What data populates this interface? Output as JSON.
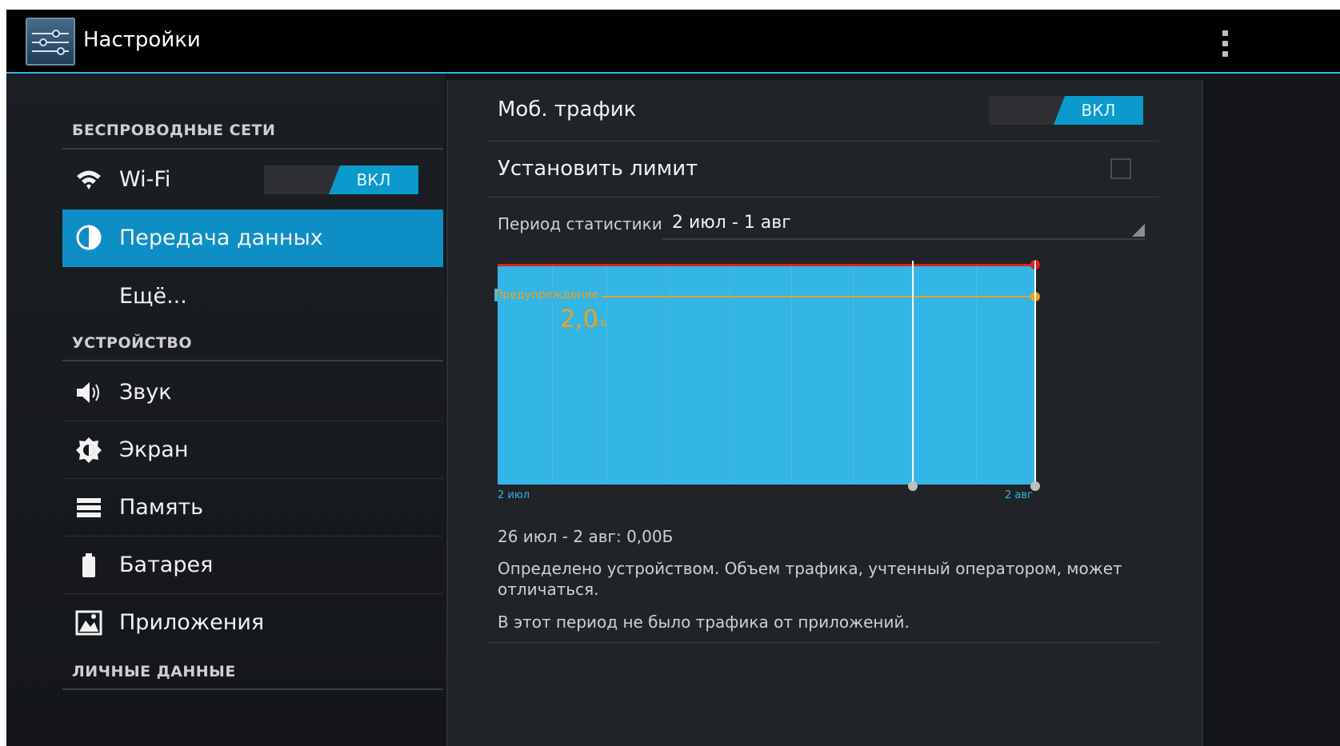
{
  "app": {
    "title": "Настройки",
    "icon": "settings-sliders-icon"
  },
  "sidebar": {
    "sections": [
      {
        "label": "БЕСПРОВОДНЫЕ СЕТИ"
      },
      {
        "label": "УСТРОЙСТВО"
      },
      {
        "label": "ЛИЧНЫЕ ДАННЫЕ"
      }
    ],
    "items": [
      {
        "label": "Wi-Fi",
        "icon": "wifi-icon",
        "toggle": "ВКЛ"
      },
      {
        "label": "Передача данных",
        "icon": "data-usage-icon",
        "selected": true
      },
      {
        "label": "Ещё...",
        "icon": ""
      },
      {
        "label": "Звук",
        "icon": "volume-icon"
      },
      {
        "label": "Экран",
        "icon": "brightness-icon"
      },
      {
        "label": "Память",
        "icon": "storage-icon"
      },
      {
        "label": "Батарея",
        "icon": "battery-icon"
      },
      {
        "label": "Приложения",
        "icon": "apps-icon"
      }
    ]
  },
  "data_usage": {
    "mobile_traffic": {
      "label": "Моб. трафик",
      "toggle": "ВКЛ"
    },
    "set_limit": {
      "label": "Установить лимит",
      "checked": false
    },
    "period": {
      "label": "Период статистики",
      "value": "2 июл - 1 авг"
    },
    "chart": {
      "warning_label": "Предупреждение",
      "warning_value": "2,0",
      "warning_unit": "ГБ",
      "x_start": "2 июл",
      "x_end": "2 авг"
    },
    "summary": "26 июл - 2 авг: 0,00Б",
    "note": "Определено устройством. Объем трафика, учтенный оператором, может отличаться.",
    "no_apps": "В этот период не было трафика от приложений."
  },
  "colors": {
    "accent": "#33b5e5",
    "selected": "#0d8fc6",
    "limit": "#e01e1e",
    "warning": "#f0a020"
  }
}
